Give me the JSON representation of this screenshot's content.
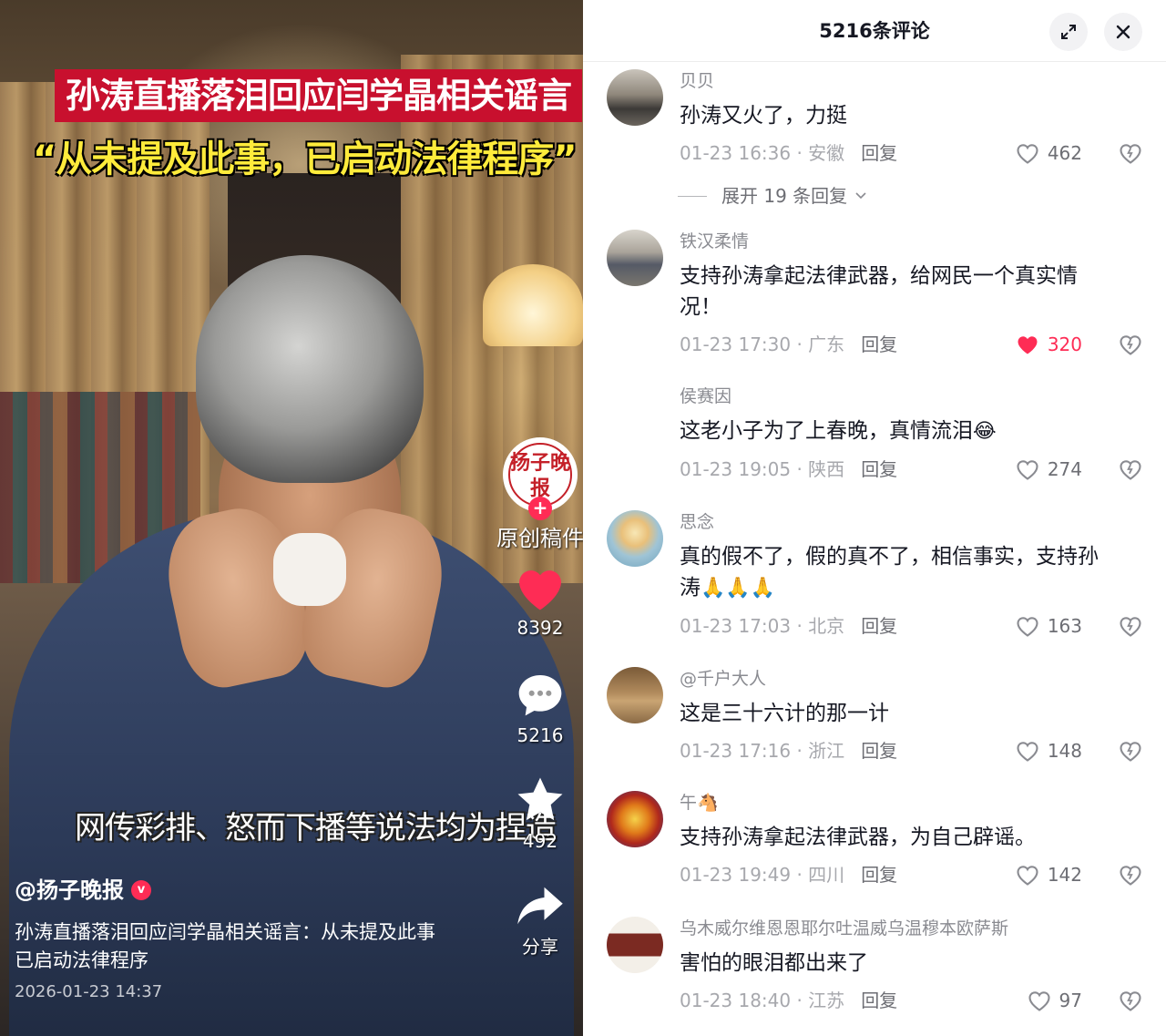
{
  "video": {
    "headline_top": "孙涛直播落泪回应闫学晶相关谣言",
    "headline_quote": "“从未提及此事，已启动法律程序”",
    "subtitle": "网传彩排、怒而下播等说法均为捏造",
    "author": "@扬子晚报",
    "caption": "孙涛直播落泪回应闫学晶相关谣言：从未提及此事 已启动法律程序",
    "timestamp": "2026-01-23 14:37",
    "seal_text": "扬子晚报",
    "original_tag": "原创稿件",
    "likes": "8392",
    "comments": "5216",
    "favorites": "492",
    "share_label": "分享"
  },
  "panel": {
    "title": "5216条评论",
    "expand_replies_label": "展开 19 条回复"
  },
  "comments": [
    {
      "user": "贝贝",
      "text": "孙涛又火了，力挺",
      "date": "01-23 16:36 · 安徽",
      "reply": "回复",
      "likes": "462",
      "liked": false
    },
    {
      "user": "铁汉柔情",
      "text": "支持孙涛拿起法律武器，给网民一个真实情况！",
      "date": "01-23 17:30 · 广东",
      "reply": "回复",
      "likes": "320",
      "liked": true
    },
    {
      "user": "侯赛因",
      "text": "这老小子为了上春晚，真情流泪",
      "emoji": "😂",
      "date": "01-23 19:05 · 陕西",
      "reply": "回复",
      "likes": "274",
      "liked": false
    },
    {
      "user": "思念",
      "text": "真的假不了，假的真不了，相信事实，支持孙涛",
      "emoji": "🙏🙏🙏",
      "date": "01-23 17:03 · 北京",
      "reply": "回复",
      "likes": "163",
      "liked": false
    },
    {
      "user": "@千户大人",
      "text": "这是三十六计的那一计",
      "date": "01-23 17:16 · 浙江",
      "reply": "回复",
      "likes": "148",
      "liked": false
    },
    {
      "user": "午",
      "user_emoji": "🐴",
      "text": "支持孙涛拿起法律武器，为自己辟谣。",
      "date": "01-23 19:49 · 四川",
      "reply": "回复",
      "likes": "142",
      "liked": false
    },
    {
      "user": "乌木威尔维恩恩耶尔吐温威乌温穆本欧萨斯",
      "text": "害怕的眼泪都出来了",
      "date": "01-23 18:40 · 江苏",
      "reply": "回复",
      "likes": "97",
      "liked": false
    }
  ],
  "colors": {
    "accent": "#fe2c55",
    "headline_bg": "#c8102e",
    "headline_quote": "#ffeb3b",
    "text_primary": "#161823",
    "text_secondary": "#8a8b91"
  }
}
